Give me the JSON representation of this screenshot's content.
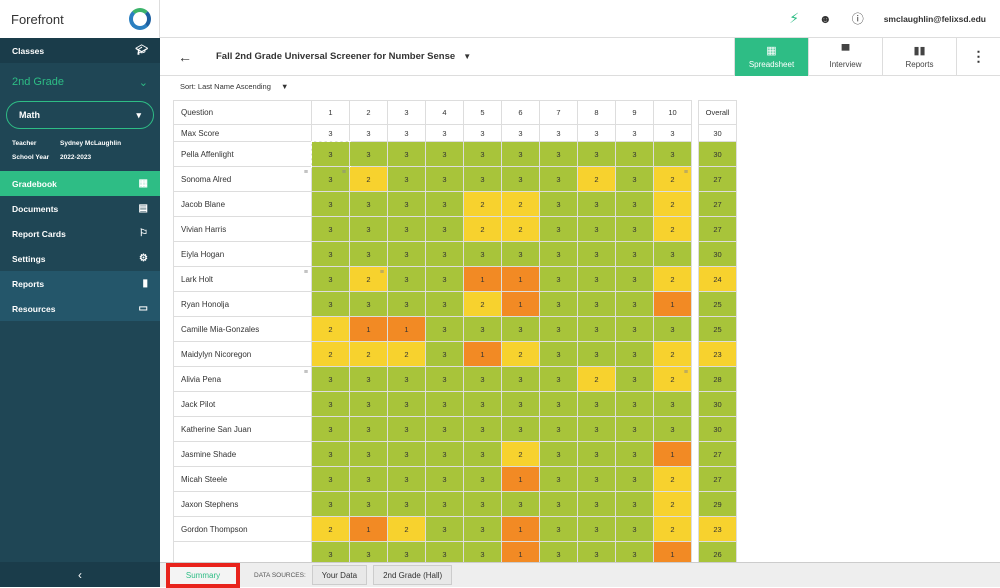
{
  "app": {
    "name": "Forefront"
  },
  "sidebar": {
    "classes": "Classes",
    "grade": "2nd Grade",
    "subject": "Math",
    "teacher_label": "Teacher",
    "teacher": "Sydney McLaughlin",
    "year_label": "School Year",
    "year": "2022-2023",
    "items": [
      {
        "label": "Gradebook",
        "icon": "grid-icon",
        "active": true
      },
      {
        "label": "Documents",
        "icon": "document-icon"
      },
      {
        "label": "Report Cards",
        "icon": "flag-icon"
      },
      {
        "label": "Settings",
        "icon": "gear-icon"
      },
      {
        "label": "Reports",
        "icon": "bar-chart-icon"
      },
      {
        "label": "Resources",
        "icon": "folder-icon"
      }
    ]
  },
  "topbar": {
    "email": "smclaughlin@felixsd.edu"
  },
  "toolbar": {
    "title": "Fall 2nd Grade Universal Screener for Number Sense",
    "tabs": [
      "Spreadsheet",
      "Interview",
      "Reports"
    ],
    "active_tab": "Spreadsheet"
  },
  "sort": "Sort: Last Name Ascending",
  "colors": {
    "accent": "#2ebd85",
    "score_3": "#a8c43a",
    "score_2": "#f7d22e",
    "score_1": "#f28a24",
    "sidebar": "#1f4655"
  },
  "grid": {
    "question_label": "Question",
    "max_label": "Max Score",
    "overall_label": "Overall",
    "questions": [
      "1",
      "2",
      "3",
      "4",
      "5",
      "6",
      "7",
      "8",
      "9",
      "10"
    ],
    "max_scores": [
      3,
      3,
      3,
      3,
      3,
      3,
      3,
      3,
      3,
      3
    ],
    "max_total": 30,
    "students": [
      {
        "name": "Pella Affenlight",
        "scores": [
          3,
          3,
          3,
          3,
          3,
          3,
          3,
          3,
          3,
          3
        ],
        "overall": 30
      },
      {
        "name": "Sonoma Alred",
        "scores": [
          3,
          2,
          3,
          3,
          3,
          3,
          3,
          2,
          3,
          2
        ],
        "overall": 27,
        "notes": [
          0,
          9
        ],
        "name_note": true
      },
      {
        "name": "Jacob Blane",
        "scores": [
          3,
          3,
          3,
          3,
          2,
          2,
          3,
          3,
          3,
          2
        ],
        "overall": 27
      },
      {
        "name": "Vivian Harris",
        "scores": [
          3,
          3,
          3,
          3,
          2,
          2,
          3,
          3,
          3,
          2
        ],
        "overall": 27
      },
      {
        "name": "Eiyla Hogan",
        "scores": [
          3,
          3,
          3,
          3,
          3,
          3,
          3,
          3,
          3,
          3
        ],
        "overall": 30
      },
      {
        "name": "Lark Holt",
        "scores": [
          3,
          2,
          3,
          3,
          1,
          1,
          3,
          3,
          3,
          2
        ],
        "overall": 24,
        "notes": [
          1
        ],
        "name_note": true
      },
      {
        "name": "Ryan Honolja",
        "scores": [
          3,
          3,
          3,
          3,
          2,
          1,
          3,
          3,
          3,
          1
        ],
        "overall": 25
      },
      {
        "name": "Camille Mia-Gonzales",
        "scores": [
          2,
          1,
          1,
          3,
          3,
          3,
          3,
          3,
          3,
          3
        ],
        "overall": 25
      },
      {
        "name": "Maidylyn Nicoregon",
        "scores": [
          2,
          2,
          2,
          3,
          1,
          2,
          3,
          3,
          3,
          2
        ],
        "overall": 23
      },
      {
        "name": "Alivia Pena",
        "scores": [
          3,
          3,
          3,
          3,
          3,
          3,
          3,
          2,
          3,
          2
        ],
        "overall": 28,
        "notes": [
          9
        ],
        "name_note": true
      },
      {
        "name": "Jack Pilot",
        "scores": [
          3,
          3,
          3,
          3,
          3,
          3,
          3,
          3,
          3,
          3
        ],
        "overall": 30
      },
      {
        "name": "Katherine San Juan",
        "scores": [
          3,
          3,
          3,
          3,
          3,
          3,
          3,
          3,
          3,
          3
        ],
        "overall": 30
      },
      {
        "name": "Jasmine Shade",
        "scores": [
          3,
          3,
          3,
          3,
          3,
          2,
          3,
          3,
          3,
          1
        ],
        "overall": 27
      },
      {
        "name": "Micah Steele",
        "scores": [
          3,
          3,
          3,
          3,
          3,
          1,
          3,
          3,
          3,
          2
        ],
        "overall": 27
      },
      {
        "name": "Jaxon Stephens",
        "scores": [
          3,
          3,
          3,
          3,
          3,
          3,
          3,
          3,
          3,
          2
        ],
        "overall": 29
      },
      {
        "name": "Gordon Thompson",
        "scores": [
          2,
          1,
          2,
          3,
          3,
          1,
          3,
          3,
          3,
          2
        ],
        "overall": 23
      },
      {
        "name": "",
        "scores": [
          3,
          3,
          3,
          3,
          3,
          1,
          3,
          3,
          3,
          1
        ],
        "overall": 26
      }
    ]
  },
  "bottom": {
    "summary": "Summary",
    "data_sources_label": "DATA SOURCES:",
    "sources": [
      "Your Data",
      "2nd Grade (Hall)"
    ]
  }
}
